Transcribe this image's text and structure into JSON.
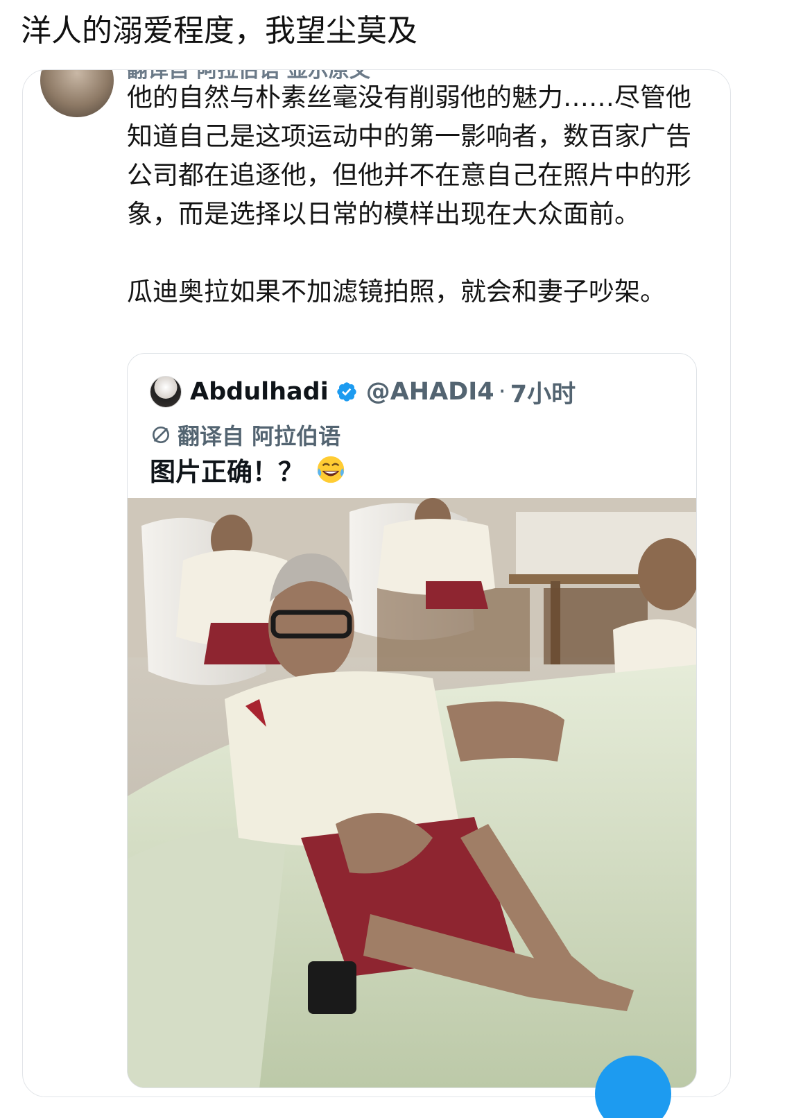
{
  "caption": "洋人的溺爱程度，我望尘莫及",
  "tweet": {
    "header_partial": "翻译自 阿拉伯语 显示原文",
    "text_para1": "他的自然与朴素丝毫没有削弱他的魅力……尽管他知道自己是这项运动中的第一影响者，数百家广告公司都在追逐他，但他并不在意自己在照片中的形象，而是选择以日常的模样出现在大众面前。",
    "text_para2": "瓜迪奥拉如果不加滤镜拍照，就会和妻子吵架。"
  },
  "quote": {
    "name": "Abdulhadi",
    "handle": "@AHADI4",
    "separator": "·",
    "time": "7小时",
    "translated_label": "翻译自 阿拉伯语",
    "body": "图片正确！？",
    "emoji": "face-with-tears-of-joy",
    "verified_icon": "verified-badge-icon",
    "photo": "photo of people in training kits relaxing on lounge chairs and a sofa"
  },
  "colors": {
    "accent": "#1d9bf0",
    "secondary_text": "#536471",
    "border": "#dfe3e7"
  }
}
